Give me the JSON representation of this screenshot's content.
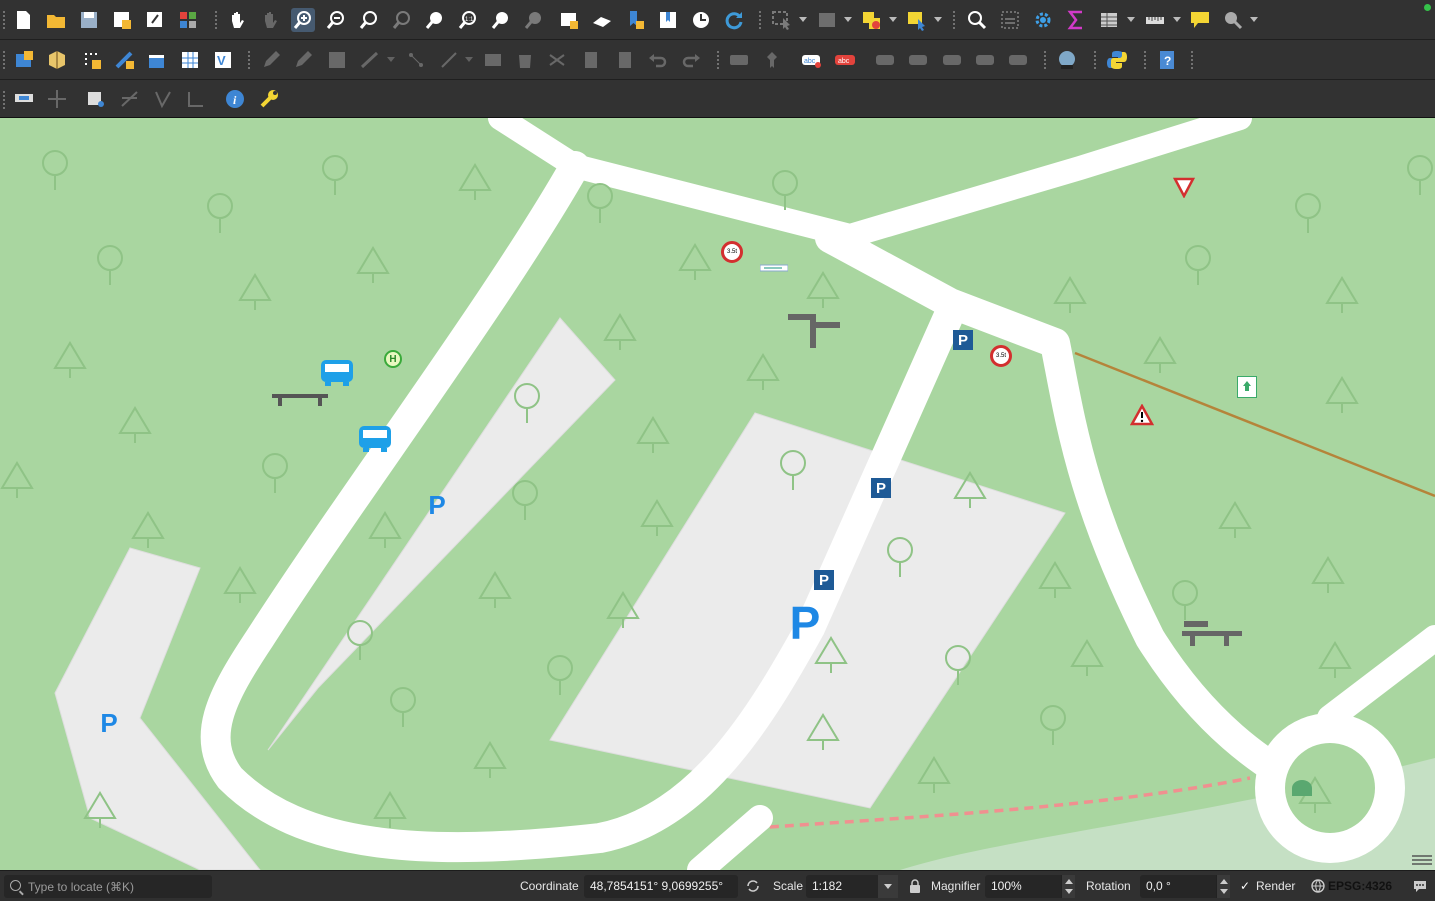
{
  "toolbar": {
    "project": [
      "new-project",
      "open-project",
      "save-project",
      "new-print-layout",
      "layout-manager",
      "style-manager"
    ],
    "navigation": [
      "pan-map",
      "pan-to-selection",
      "zoom-in",
      "zoom-out",
      "zoom-full",
      "zoom-to-selection",
      "zoom-to-layer",
      "zoom-native",
      "zoom-last",
      "zoom-next",
      "new-map-view",
      "new-3d-map-view",
      "new-bookmark",
      "show-bookmarks",
      "temporal-controller",
      "refresh"
    ],
    "attributes": [
      "identify-features",
      "select-features",
      "select-by-value",
      "deselect",
      "field-calculator",
      "statistical-summary",
      "open-attribute-table",
      "measure",
      "map-tips",
      "locator-filter"
    ],
    "data_source": [
      "data-source-manager",
      "new-geopackage-layer",
      "new-temporary-scratch-layer",
      "digitize-with-segment",
      "new-shapefile-layer",
      "virtual-layer",
      "new-spatialite-layer"
    ],
    "digitizing": [
      "current-edits",
      "toggle-editing",
      "save-layer-edits",
      "add-feature",
      "vertex-tool",
      "modify-attributes",
      "delete-selected",
      "cut-features",
      "copy-features",
      "paste-features",
      "undo",
      "redo"
    ],
    "labels": [
      "layer-labeling",
      "pin-labels",
      "highlight-pinned",
      "rule-labels",
      "show-hide-labels",
      "preview-labels",
      "move-label",
      "rotate-label",
      "change-label"
    ],
    "plugins": [
      "plugin-globe",
      "python-console",
      "help"
    ],
    "advanced": [
      "advanced-digitizing",
      "snapping",
      "vertex-editor",
      "reshape",
      "offset",
      "reverse",
      "identify",
      "tools"
    ]
  },
  "map": {
    "background_color": "#a9d6a0",
    "road_color": "#ffffff",
    "parking_area_color": "#eaeaea",
    "parking_icon_blue": "#1e5a96",
    "parking_text_blue": "#1e88e5",
    "warning_red": "#d32f2f",
    "power_line_color": "#b5843a",
    "path_color": "#f08080",
    "markers": {
      "parking_sign_label": "P",
      "bus_stop_label": "H",
      "speed_limit_label": "3.5t"
    }
  },
  "statusbar": {
    "locator_placeholder": "Type to locate (⌘K)",
    "coordinate_label": "Coordinate",
    "coordinate_value": "48,7854151° 9,0699255°",
    "scale_label": "Scale",
    "scale_value": "1:182",
    "magnifier_label": "Magnifier",
    "magnifier_value": "100%",
    "rotation_label": "Rotation",
    "rotation_value": "0,0 °",
    "render_label": "Render",
    "render_checked": "✓",
    "crs_label": "EPSG:4326"
  }
}
